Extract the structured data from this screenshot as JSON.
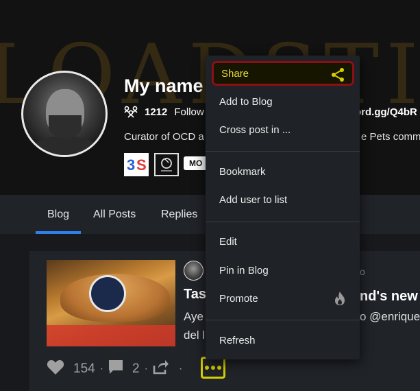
{
  "banner": {
    "art_text": "LOADSTI"
  },
  "profile": {
    "name": "My name",
    "followers_count": "1212",
    "followers_label": "Follow",
    "discord_fragment": "ord.gg/Q4bR",
    "bio_left": "Curator of OCD a",
    "bio_right": "e Pets comm",
    "badge_3s": "3S",
    "more_badge": "MO"
  },
  "tabs": [
    {
      "label": "Blog",
      "active": true
    },
    {
      "label": "All Posts"
    },
    {
      "label": "Replies"
    }
  ],
  "post": {
    "title_fragment": "Tas",
    "title_right": "nd's new r",
    "meta_right": "o",
    "excerpt_line1": "Aye",
    "excerpt_line1_right": "o @enrique",
    "excerpt_line2": "del l",
    "likes": "154",
    "comments": "2"
  },
  "menu": {
    "items": [
      {
        "label": "Share",
        "icon": "share-icon",
        "highlighted": true
      },
      {
        "label": "Add to Blog"
      },
      {
        "label": "Cross post in ..."
      },
      {
        "label": "Bookmark"
      },
      {
        "label": "Add user to list"
      },
      {
        "label": "Edit"
      },
      {
        "label": "Pin in Blog"
      },
      {
        "label": "Promote",
        "icon": "fire-icon"
      },
      {
        "label": "Refresh"
      }
    ]
  },
  "colors": {
    "accent_blue": "#2f80ed",
    "highlight_yellow": "#d7cf00",
    "highlight_red": "#8c0f15"
  }
}
